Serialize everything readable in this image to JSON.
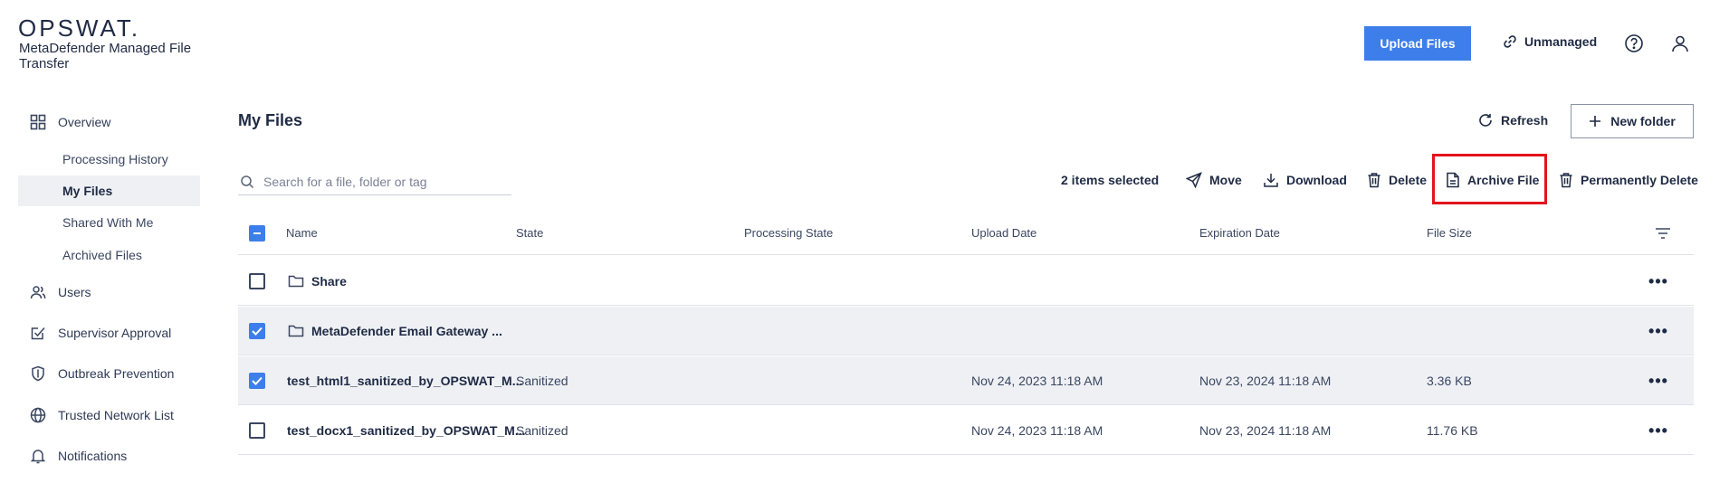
{
  "brand": {
    "logo": "OPSWAT.",
    "product": "MetaDefender Managed File Transfer"
  },
  "sidebar": {
    "items": [
      {
        "label": "Overview",
        "icon": "grid-icon"
      },
      {
        "label": "Processing History"
      },
      {
        "label": "My Files",
        "active": true
      },
      {
        "label": "Shared With Me"
      },
      {
        "label": "Archived Files"
      },
      {
        "label": "Users",
        "icon": "users-icon"
      },
      {
        "label": "Supervisor Approval",
        "icon": "approval-icon"
      },
      {
        "label": "Outbreak Prevention",
        "icon": "shield-icon"
      },
      {
        "label": "Trusted Network List",
        "icon": "globe-icon"
      },
      {
        "label": "Notifications",
        "icon": "bell-icon"
      }
    ]
  },
  "header": {
    "upload_label": "Upload Files",
    "unmanaged_label": "Unmanaged"
  },
  "main": {
    "title": "My Files",
    "refresh_label": "Refresh",
    "new_folder_label": "New folder",
    "search_placeholder": "Search for a file, folder or tag",
    "selection_text": "2 items selected",
    "actions": {
      "move": "Move",
      "download": "Download",
      "delete": "Delete",
      "archive": "Archive File",
      "permanent_delete": "Permanently Delete"
    }
  },
  "table": {
    "columns": [
      "Name",
      "State",
      "Processing State",
      "Upload Date",
      "Expiration Date",
      "File Size"
    ],
    "rows": [
      {
        "type": "folder",
        "checked": false,
        "name": "Share",
        "state": "",
        "processing": "",
        "upload": "",
        "expiration": "",
        "size": ""
      },
      {
        "type": "folder",
        "checked": true,
        "name": "MetaDefender Email Gateway ...",
        "state": "",
        "processing": "",
        "upload": "",
        "expiration": "",
        "size": ""
      },
      {
        "type": "file",
        "checked": true,
        "name": "test_html1_sanitized_by_OPSWAT_M...",
        "state": "Sanitized",
        "processing": "",
        "upload": "Nov 24, 2023 11:18 AM",
        "expiration": "Nov 23, 2024 11:18 AM",
        "size": "3.36 KB"
      },
      {
        "type": "file",
        "checked": false,
        "name": "test_docx1_sanitized_by_OPSWAT_M...",
        "state": "Sanitized",
        "processing": "",
        "upload": "Nov 24, 2023 11:18 AM",
        "expiration": "Nov 23, 2024 11:18 AM",
        "size": "11.76 KB"
      }
    ]
  },
  "colors": {
    "accent": "#3d7eea",
    "highlight": "#e3141c",
    "selected_row": "#eef0f4"
  }
}
